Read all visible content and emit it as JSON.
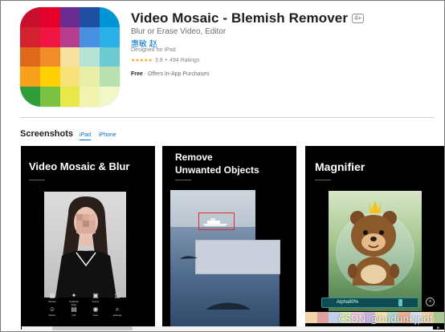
{
  "app": {
    "title": "Video Mosaic - Blemish Remover",
    "age_rating": "4+",
    "subtitle": "Blur or Erase Video, Editor",
    "developer": "惠敏 赵",
    "designed_for": "Designed for iPad",
    "rating_value": "3.9",
    "rating_separator": "•",
    "rating_count": "494 Ratings",
    "price": "Free",
    "price_separator": "·",
    "iap": "Offers In-App Purchases",
    "icon_colors": [
      "#c8102e",
      "#e4002b",
      "#6a2c91",
      "#1f4fa3",
      "#0096d6",
      "#d3212f",
      "#f0163f",
      "#b53e8f",
      "#4a90e2",
      "#2cb1e6",
      "#e06a1b",
      "#f28c28",
      "#f7e1a0",
      "#b5e3d8",
      "#6ccad0",
      "#f7a21b",
      "#ffd100",
      "#f7e27a",
      "#e7f0a6",
      "#b8e0b0",
      "#2e9d3a",
      "#7cc242",
      "#e8e84a",
      "#f3f3b0",
      "#f2f7c8"
    ]
  },
  "screenshots": {
    "heading": "Screenshots",
    "tabs": [
      "iPad",
      "iPhone"
    ],
    "shot1": {
      "caption": "Video Mosaic & Blur",
      "tools": [
        {
          "label": "Mosaic",
          "icon": "checker-icon"
        },
        {
          "label": "Celebrity Filter",
          "icon": "sparkle-icon"
        },
        {
          "label": "Frame",
          "icon": "square-icon"
        },
        {
          "label": "",
          "icon": "blank-icon"
        },
        {
          "label": "Sticker",
          "icon": "smile-icon"
        },
        {
          "label": "GIF",
          "icon": "gif-icon"
        },
        {
          "label": "Face",
          "icon": "face-icon"
        },
        {
          "label": "Enlarge",
          "icon": "magnify-icon"
        }
      ]
    },
    "shot2": {
      "caption_line1": "Remove",
      "caption_line2": "Unwanted Objects"
    },
    "shot3": {
      "caption": "Magnifier",
      "slider_label": "Alpha80%",
      "close_glyph": "×",
      "strip_colors": [
        "#f2d5a6",
        "#e0a0a0",
        "#c0d0e8",
        "#d9e8b5",
        "#f0c6d8",
        "#c8b4e0",
        "#f5e0a8",
        "#b0d4c8",
        "#e8b090",
        "#d4e0f0",
        "#f0d0a0",
        "#a8c890"
      ]
    }
  },
  "watermark": "CSDN @hudunkjpdf",
  "scroll_left": "◀",
  "scroll_right": "▶"
}
